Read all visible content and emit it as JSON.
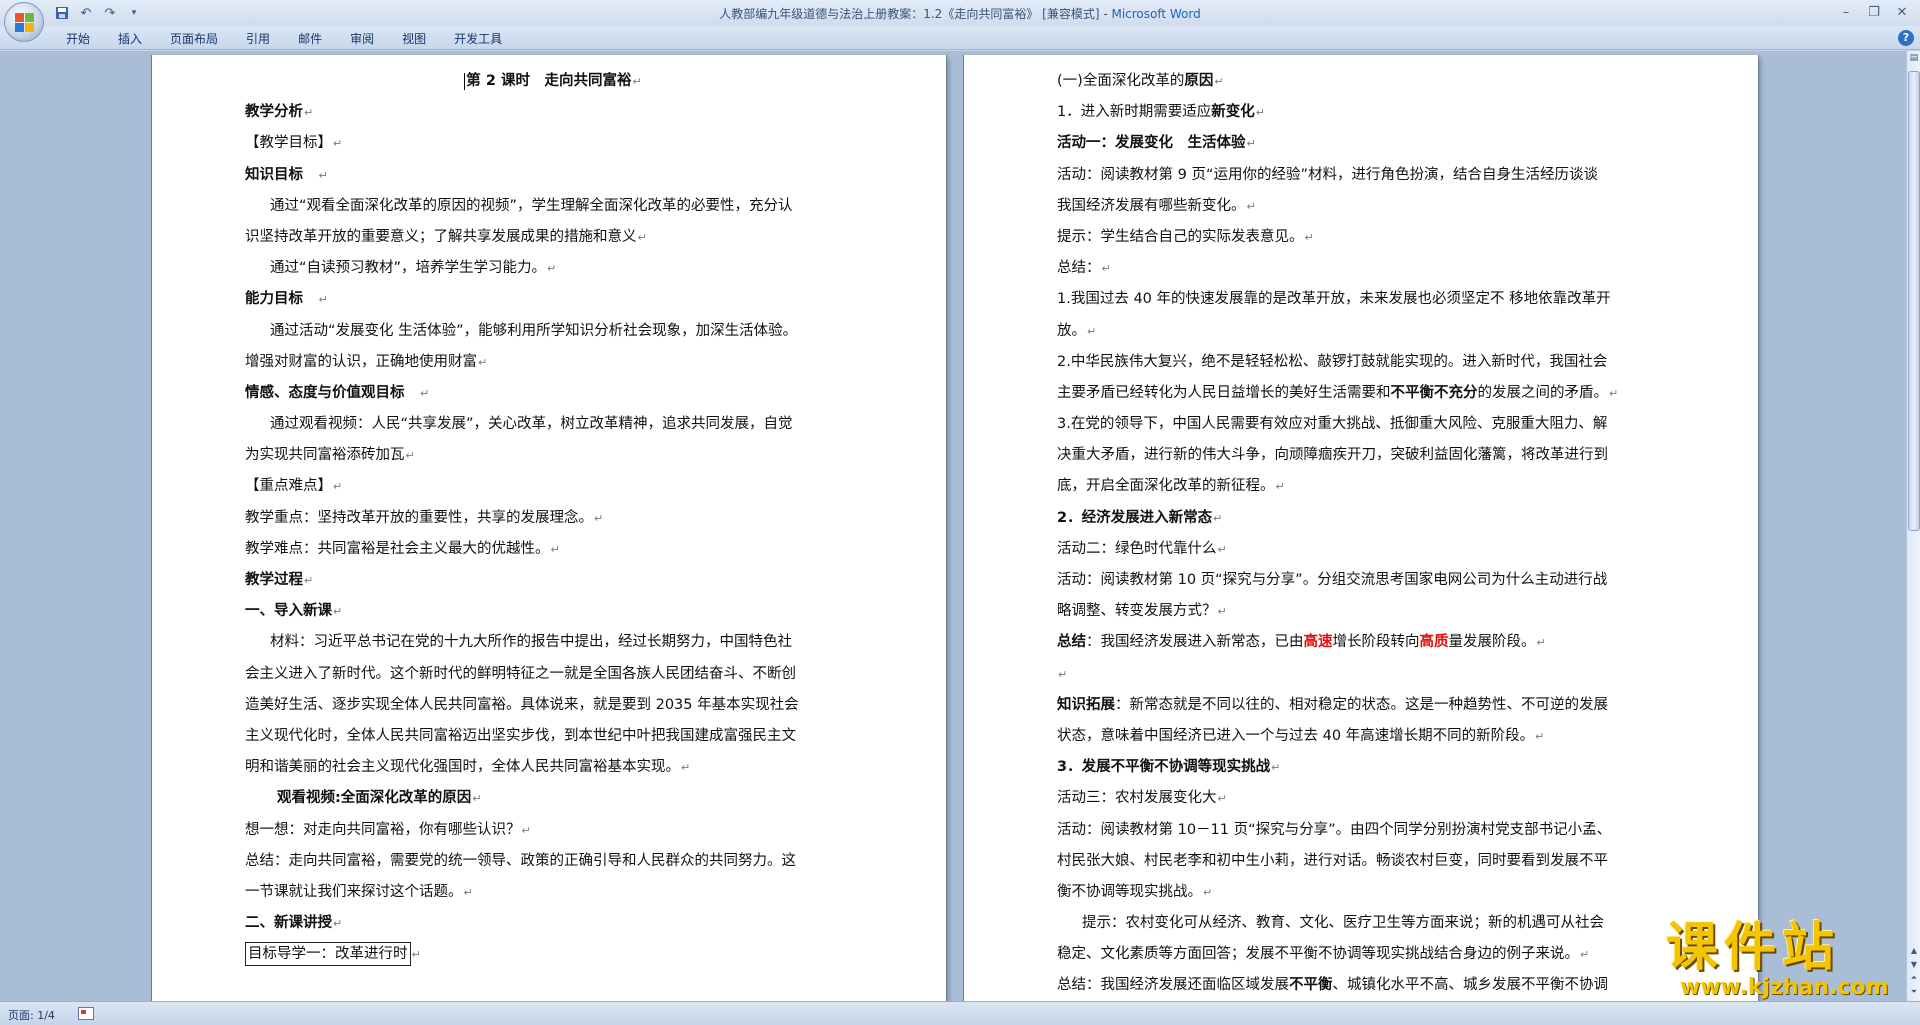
{
  "window": {
    "title_doc": "人教部编九年级道德与法治上册教案：1.2《走向共同富裕》 [兼容模式] - ",
    "title_app": "Microsoft Word"
  },
  "ribbon": {
    "tabs": [
      "开始",
      "插入",
      "页面布局",
      "引用",
      "邮件",
      "审阅",
      "视图",
      "开发工具"
    ]
  },
  "document": {
    "left_page": [
      {
        "segments": [
          {
            "t": "第 2 课时　走向共同富裕",
            "b": true
          }
        ],
        "style": "center",
        "cursor": true
      },
      {
        "segments": [
          {
            "t": "教学分析",
            "b": true
          }
        ]
      },
      {
        "segments": [
          {
            "t": "【教学目标】"
          }
        ]
      },
      {
        "segments": [
          {
            "t": "知识目标　",
            "b": true
          }
        ]
      },
      {
        "segments": [
          {
            "t": "通过“观看全面深化改革的原因的视频”，学生理解全面深化改革的必要性，充分认"
          }
        ],
        "style": "indent",
        "nomark": true
      },
      {
        "segments": [
          {
            "t": "识坚持改革开放的重要意义；了解共享发展成果的措施和意义"
          }
        ]
      },
      {
        "segments": [
          {
            "t": "通过“自读预习教材”，培养学生学习能力。"
          }
        ],
        "style": "indent"
      },
      {
        "segments": [
          {
            "t": "能力目标　",
            "b": true
          }
        ]
      },
      {
        "segments": [
          {
            "t": "通过活动“发展变化 生活体验”，能够利用所学知识分析社会现象，加深生活体验。"
          }
        ],
        "style": "indent",
        "nomark": true
      },
      {
        "segments": [
          {
            "t": "增强对财富的认识，正确地使用财富"
          }
        ]
      },
      {
        "segments": [
          {
            "t": "情感、态度与价值观目标　",
            "b": true
          }
        ]
      },
      {
        "segments": [
          {
            "t": "通过观看视频：人民“共享发展”，关心改革，树立改革精神，追求共同发展，自觉"
          }
        ],
        "style": "indent",
        "nomark": true
      },
      {
        "segments": [
          {
            "t": "为实现共同富裕添砖加瓦"
          }
        ]
      },
      {
        "segments": [
          {
            "t": "【重点难点】"
          }
        ]
      },
      {
        "segments": [
          {
            "t": "教学重点：坚持改革开放的重要性，共享的发展理念。"
          }
        ]
      },
      {
        "segments": [
          {
            "t": "教学难点：共同富裕是社会主义最大的优越性。"
          }
        ]
      },
      {
        "segments": [
          {
            "t": "教学过程",
            "b": true
          }
        ]
      },
      {
        "segments": [
          {
            "t": "一、导入新课",
            "b": true
          }
        ]
      },
      {
        "segments": [
          {
            "t": "材料：习近平总书记在党的十九大所作的报告中提出，经过长期努力，中国特色社"
          }
        ],
        "style": "indent",
        "nomark": true
      },
      {
        "segments": [
          {
            "t": "会主义进入了新时代。这个新时代的鲜明特征之一就是全国各族人民团结奋斗、不断创"
          }
        ],
        "nomark": true
      },
      {
        "segments": [
          {
            "t": "造美好生活、逐步实现全体人民共同富裕。具体说来，就是要到 2035 年基本实现社会"
          }
        ],
        "nomark": true
      },
      {
        "segments": [
          {
            "t": "主义现代化时，全体人民共同富裕迈出坚实步伐，到本世纪中叶把我国建成富强民主文"
          }
        ],
        "nomark": true
      },
      {
        "segments": [
          {
            "t": "明和谐美丽的社会主义现代化强国时，全体人民共同富裕基本实现。"
          }
        ]
      },
      {
        "segments": [
          {
            "t": "观看视频:全面深化改革的原因",
            "b": true
          }
        ],
        "style": "indent2"
      },
      {
        "segments": [
          {
            "t": "想一想：对走向共同富裕，你有哪些认识？"
          }
        ]
      },
      {
        "segments": [
          {
            "t": "总结：走向共同富裕，需要党的统一领导、政策的正确引导和人民群众的共同努力。这"
          }
        ],
        "nomark": true
      },
      {
        "segments": [
          {
            "t": "一节课就让我们来探讨这个话题。"
          }
        ]
      },
      {
        "segments": [
          {
            "t": "二、新课讲授",
            "b": true
          }
        ]
      },
      {
        "segments": [
          {
            "t": "目标导学一：改革进行时"
          }
        ],
        "boxed": true
      }
    ],
    "right_page": [
      {
        "segments": [
          {
            "t": "(一)全面深化改革的"
          },
          {
            "t": "原因",
            "b": true
          }
        ]
      },
      {
        "segments": [
          {
            "t": "1．进入新时期需要适应"
          },
          {
            "t": "新变化",
            "b": true
          }
        ]
      },
      {
        "segments": [
          {
            "t": "活动一：发展变化　生活体验",
            "b": true
          }
        ]
      },
      {
        "segments": [
          {
            "t": "活动：阅读教材第 9 页“运用你的经验”材料，进行角色扮演，结合自身生活经历谈谈"
          }
        ],
        "nomark": true
      },
      {
        "segments": [
          {
            "t": "我国经济发展有哪些新变化。"
          }
        ]
      },
      {
        "segments": [
          {
            "t": "提示：学生结合自己的实际发表意见。"
          }
        ]
      },
      {
        "segments": [
          {
            "t": "总结："
          }
        ]
      },
      {
        "segments": [
          {
            "t": "1.我国过去 40 年的快速发展靠的是改革开放，未来发展也必须坚定不 移地依靠改革开"
          }
        ],
        "nomark": true
      },
      {
        "segments": [
          {
            "t": "放。"
          }
        ]
      },
      {
        "segments": [
          {
            "t": "2.中华民族伟大复兴，绝不是轻轻松松、敲锣打鼓就能实现的。进入新时代，我国社会"
          }
        ],
        "nomark": true
      },
      {
        "segments": [
          {
            "t": "主要矛盾已经转化为人民日益增长的美好生活需要和"
          },
          {
            "t": "不平衡不充分",
            "b": true
          },
          {
            "t": "的发展之间的矛盾。"
          }
        ]
      },
      {
        "segments": [
          {
            "t": "3.在党的领导下，中国人民需要有效应对重大挑战、抵御重大风险、克服重大阻力、解"
          }
        ],
        "nomark": true
      },
      {
        "segments": [
          {
            "t": "决重大矛盾，进行新的伟大斗争，向顽障痼疾开刀，突破利益固化藩篱，将改革进行到"
          }
        ],
        "nomark": true
      },
      {
        "segments": [
          {
            "t": "底，开启全面深化改革的新征程。"
          }
        ]
      },
      {
        "segments": [
          {
            "t": "2．经济发展进入新常态",
            "b": true
          }
        ]
      },
      {
        "segments": [
          {
            "t": "活动二：绿色时代靠什么"
          }
        ]
      },
      {
        "segments": [
          {
            "t": "活动：阅读教材第 10 页“探究与分享”。分组交流思考国家电网公司为什么主动进行战"
          }
        ],
        "nomark": true
      },
      {
        "segments": [
          {
            "t": "略调整、转变发展方式？"
          }
        ]
      },
      {
        "segments": [
          {
            "t": "总结",
            "b": true
          },
          {
            "t": "：我国经济发展进入新常态，已由"
          },
          {
            "t": "高速",
            "r": true
          },
          {
            "t": "增长阶段转向"
          },
          {
            "t": "高质",
            "r": true
          },
          {
            "t": "量发展阶段。"
          }
        ]
      },
      {
        "segments": [
          {
            "t": ""
          }
        ]
      },
      {
        "segments": [
          {
            "t": "知识拓展",
            "b": true
          },
          {
            "t": "：新常态就是不同以往的、相对稳定的状态。这是一种趋势性、不可逆的发展"
          }
        ],
        "nomark": true
      },
      {
        "segments": [
          {
            "t": "状态，意味着中国经济已进入一个与过去 40 年高速增长期不同的新阶段。"
          }
        ]
      },
      {
        "segments": [
          {
            "t": "3．发展不平衡不协调等现实挑战",
            "b": true
          }
        ]
      },
      {
        "segments": [
          {
            "t": "活动三：农村发展变化大"
          }
        ]
      },
      {
        "segments": [
          {
            "t": "活动：阅读教材第 10－11 页“探究与分享”。由四个同学分别扮演村党支部书记小孟、"
          }
        ],
        "nomark": true
      },
      {
        "segments": [
          {
            "t": "村民张大娘、村民老李和初中生小莉，进行对话。畅谈农村巨变，同时要看到发展不平"
          }
        ],
        "nomark": true
      },
      {
        "segments": [
          {
            "t": "衡不协调等现实挑战。"
          }
        ]
      },
      {
        "segments": [
          {
            "t": "提示：农村变化可从经济、教育、文化、医疗卫生等方面来说；新的机遇可从社会"
          }
        ],
        "style": "indent",
        "nomark": true
      },
      {
        "segments": [
          {
            "t": "稳定、文化素质等方面回答；发展不平衡不协调等现实挑战结合身边的例子来说。"
          }
        ]
      },
      {
        "segments": [
          {
            "t": "总结：我国经济发展还面临区域发展"
          },
          {
            "t": "不平衡",
            "b": true
          },
          {
            "t": "、城镇化水平不高、城乡发展不平衡不协调"
          }
        ],
        "nomark": true
      }
    ]
  },
  "status": {
    "page_indicator": "页面: 1/4"
  },
  "watermark": {
    "cn": "课件站",
    "en": "www.kjzhan.com"
  },
  "icons": {
    "save": "save-icon",
    "undo": "undo-icon",
    "redo": "redo-icon",
    "customize": "customize-qat-icon",
    "help": "help-icon"
  }
}
